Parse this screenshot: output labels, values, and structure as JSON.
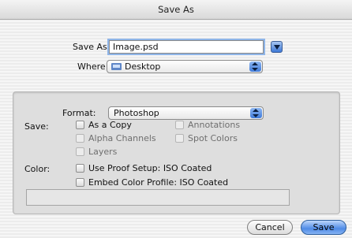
{
  "window": {
    "title": "Save As"
  },
  "save_as": {
    "label": "Save As:",
    "value": "Image.psd"
  },
  "where": {
    "label": "Where:",
    "value": "Desktop"
  },
  "format": {
    "label": "Format:",
    "value": "Photoshop"
  },
  "save_options": {
    "label": "Save:",
    "as_a_copy": "As a Copy",
    "annotations": "Annotations",
    "alpha_channels": "Alpha Channels",
    "spot_colors": "Spot Colors",
    "layers": "Layers"
  },
  "color_options": {
    "label": "Color:",
    "use_proof_setup": "Use Proof Setup:  ISO Coated",
    "embed_color_profile": "Embed Color Profile:  ISO Coated"
  },
  "buttons": {
    "cancel": "Cancel",
    "save": "Save"
  },
  "icons": {
    "expand": "disclosure-triangle-icon",
    "popup": "popup-arrows-icon",
    "folder": "desktop-folder-icon"
  },
  "colors": {
    "accent": "#3d78d6",
    "focus_ring": "#8fb5e8"
  }
}
